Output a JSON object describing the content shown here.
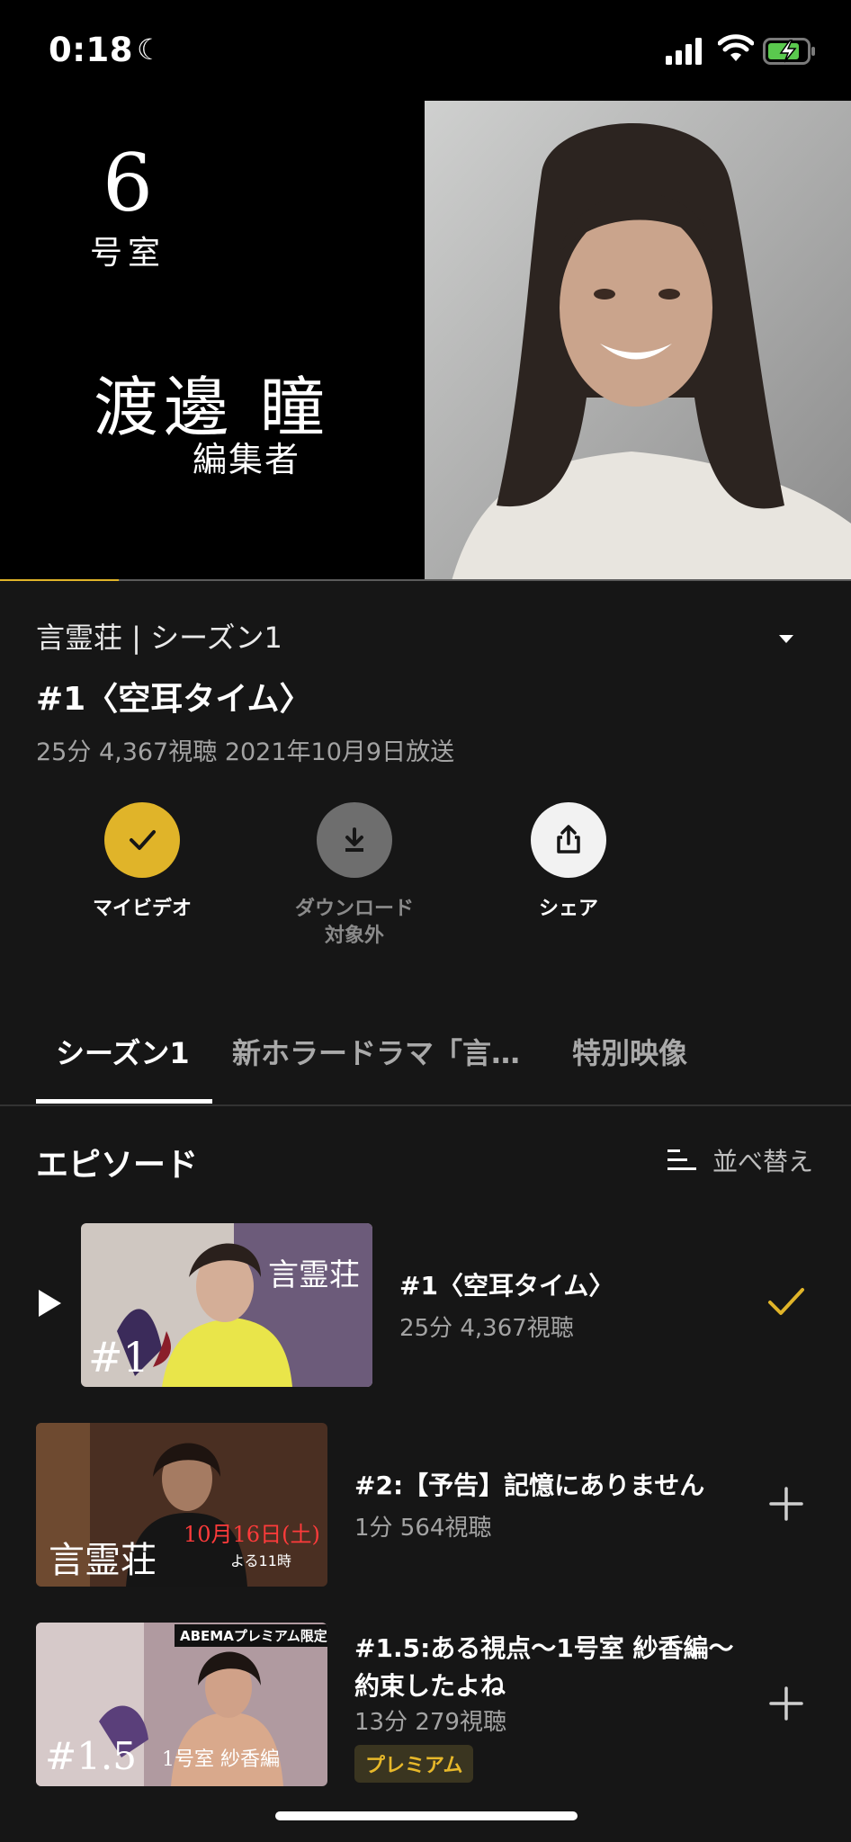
{
  "status": {
    "time": "0:18",
    "moon_icon": "☾"
  },
  "video": {
    "room_number": "6",
    "room_label": "号室",
    "person_name": "渡邊 瞳",
    "person_role": "編集者",
    "progress": 0.14
  },
  "series": {
    "title": "言霊荘 | シーズン1",
    "episode_title": "#1〈空耳タイム〉",
    "meta": "25分 4,367視聴 2021年10月9日放送"
  },
  "actions": {
    "my_video": "マイビデオ",
    "download_line1": "ダウンロード",
    "download_line2": "対象外",
    "share": "シェア"
  },
  "tabs": [
    "シーズン1",
    "新ホラードラマ「言…",
    "特別映像"
  ],
  "episodes_heading": "エピソード",
  "sort_label": "並べ替え",
  "episodes": [
    {
      "title": "#1〈空耳タイム〉",
      "sub": "25分 4,367視聴",
      "thumb_label": "#1",
      "thumb_brand": "言霊荘",
      "state": "checked"
    },
    {
      "title": "#2:【予告】記憶にありません",
      "sub": "1分 564視聴",
      "thumb_brand": "言霊荘",
      "thumb_date": "10月16日(土)",
      "thumb_time": "よる11時",
      "state": "add"
    },
    {
      "title": "#1.5:ある視点〜1号室 紗香編〜約束したよね",
      "sub": "13分 279視聴",
      "badge": "プレミアム",
      "thumb_label": "#1.5",
      "thumb_caption": "1号室 紗香編",
      "thumb_tag": "ABEMAプレミアム限定",
      "state": "add"
    }
  ],
  "colors": {
    "accent": "#e0b429",
    "background": "#161616"
  }
}
